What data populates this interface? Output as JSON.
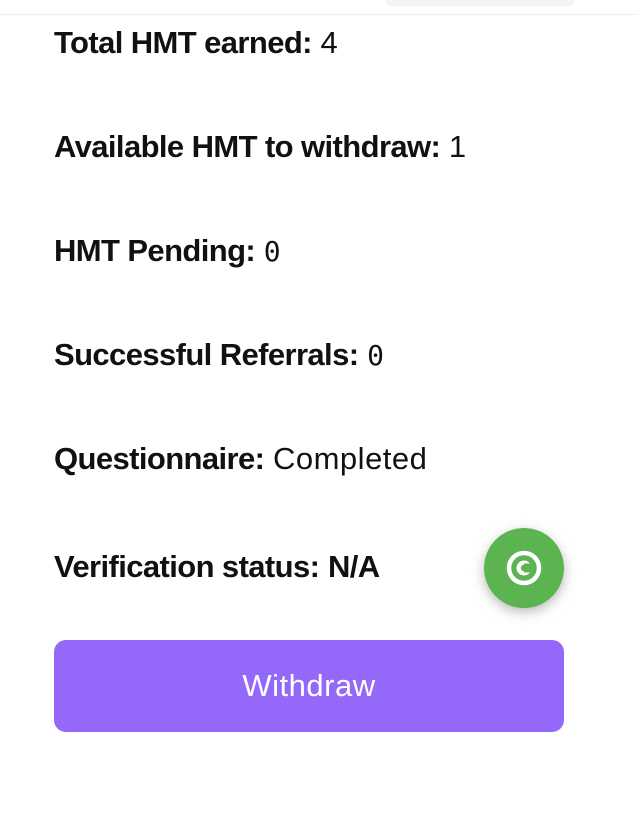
{
  "stats": {
    "total_earned": {
      "label": "Total HMT earned:",
      "value": "4"
    },
    "available": {
      "label": "Available HMT to withdraw:",
      "value": "1"
    },
    "pending": {
      "label": "HMT Pending:",
      "value": "0"
    },
    "referrals": {
      "label": "Successful Referrals:",
      "value": "0"
    },
    "questionnaire": {
      "label": "Questionnaire:",
      "value": "Completed"
    },
    "verification": {
      "label": "Verification status:",
      "value": "N/A"
    }
  },
  "fab": {
    "icon": "copyright-lock-icon",
    "color": "#5bb450"
  },
  "withdraw_button": {
    "label": "Withdraw",
    "color": "#9468f8"
  }
}
